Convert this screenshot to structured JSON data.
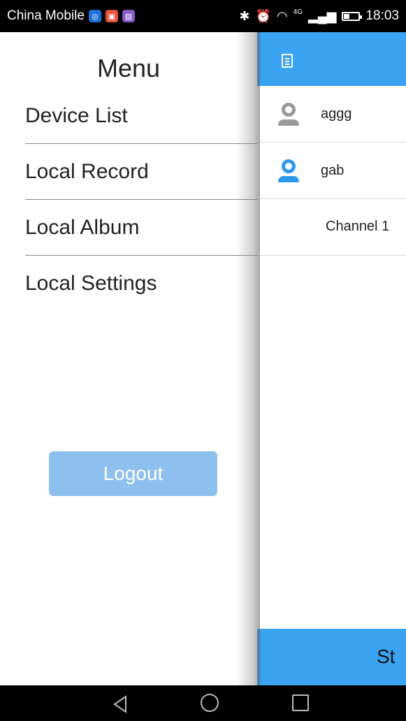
{
  "status_bar": {
    "carrier": "China Mobile",
    "network": "4G",
    "time": "18:03"
  },
  "drawer": {
    "title": "Menu",
    "items": [
      {
        "label": "Device List"
      },
      {
        "label": "Local Record"
      },
      {
        "label": "Local Album"
      },
      {
        "label": "Local Settings"
      }
    ],
    "logout_label": "Logout"
  },
  "main": {
    "devices": [
      {
        "name": "aggg",
        "status": "offline"
      },
      {
        "name": "gab",
        "status": "online"
      }
    ],
    "channel_label": "Channel 1",
    "bottom_button_label": "St"
  },
  "colors": {
    "accent": "#3aa3f2",
    "logout_button": "#8ec0ef",
    "online_icon": "#2f98ee",
    "offline_icon": "#9a9a9a"
  }
}
